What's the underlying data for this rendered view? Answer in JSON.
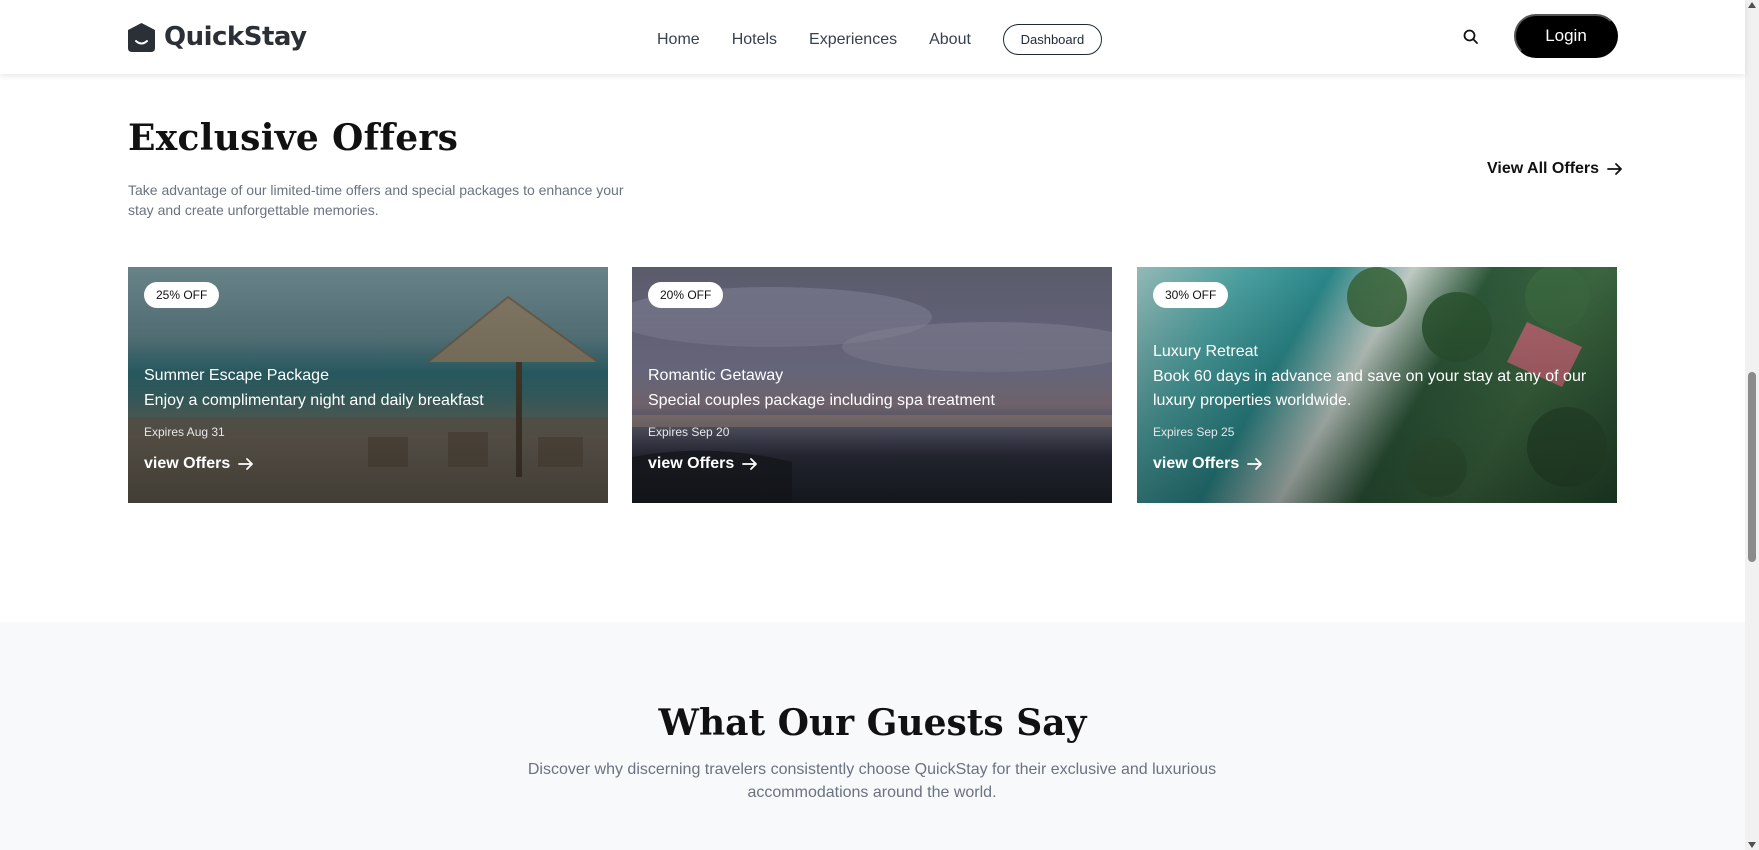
{
  "header": {
    "brand": "QuickStay",
    "nav": [
      "Home",
      "Hotels",
      "Experiences",
      "About"
    ],
    "dashboard_label": "Dashboard",
    "login_label": "Login",
    "icons": {
      "logo": "quickstay-logo-icon",
      "search": "search-icon"
    }
  },
  "offers": {
    "title": "Exclusive Offers",
    "subtitle": "Take advantage of our limited-time offers and special packages to enhance your stay and create unforgettable memories.",
    "view_all_label": "View All Offers",
    "cards": [
      {
        "badge": "25% OFF",
        "title": "Summer Escape Package",
        "description": "Enjoy a complimentary night and daily breakfast",
        "expires": "Expires Aug 31",
        "link": "view Offers"
      },
      {
        "badge": "20% OFF",
        "title": "Romantic Getaway",
        "description": "Special couples package including spa treatment",
        "expires": "Expires Sep 20",
        "link": "view Offers"
      },
      {
        "badge": "30% OFF",
        "title": "Luxury Retreat",
        "description": "Book 60 days in advance and save on your stay at any of our luxury properties worldwide.",
        "expires": "Expires Sep 25",
        "link": "view Offers"
      }
    ]
  },
  "testimonials": {
    "title": "What Our Guests Say",
    "subtitle": "Discover why discerning travelers consistently choose QuickStay for their exclusive and luxurious accommodations around the world."
  },
  "colors": {
    "accent": "#000000",
    "text": "#1f2937",
    "muted": "#6b7280",
    "section_bg": "#f8f9fb"
  }
}
